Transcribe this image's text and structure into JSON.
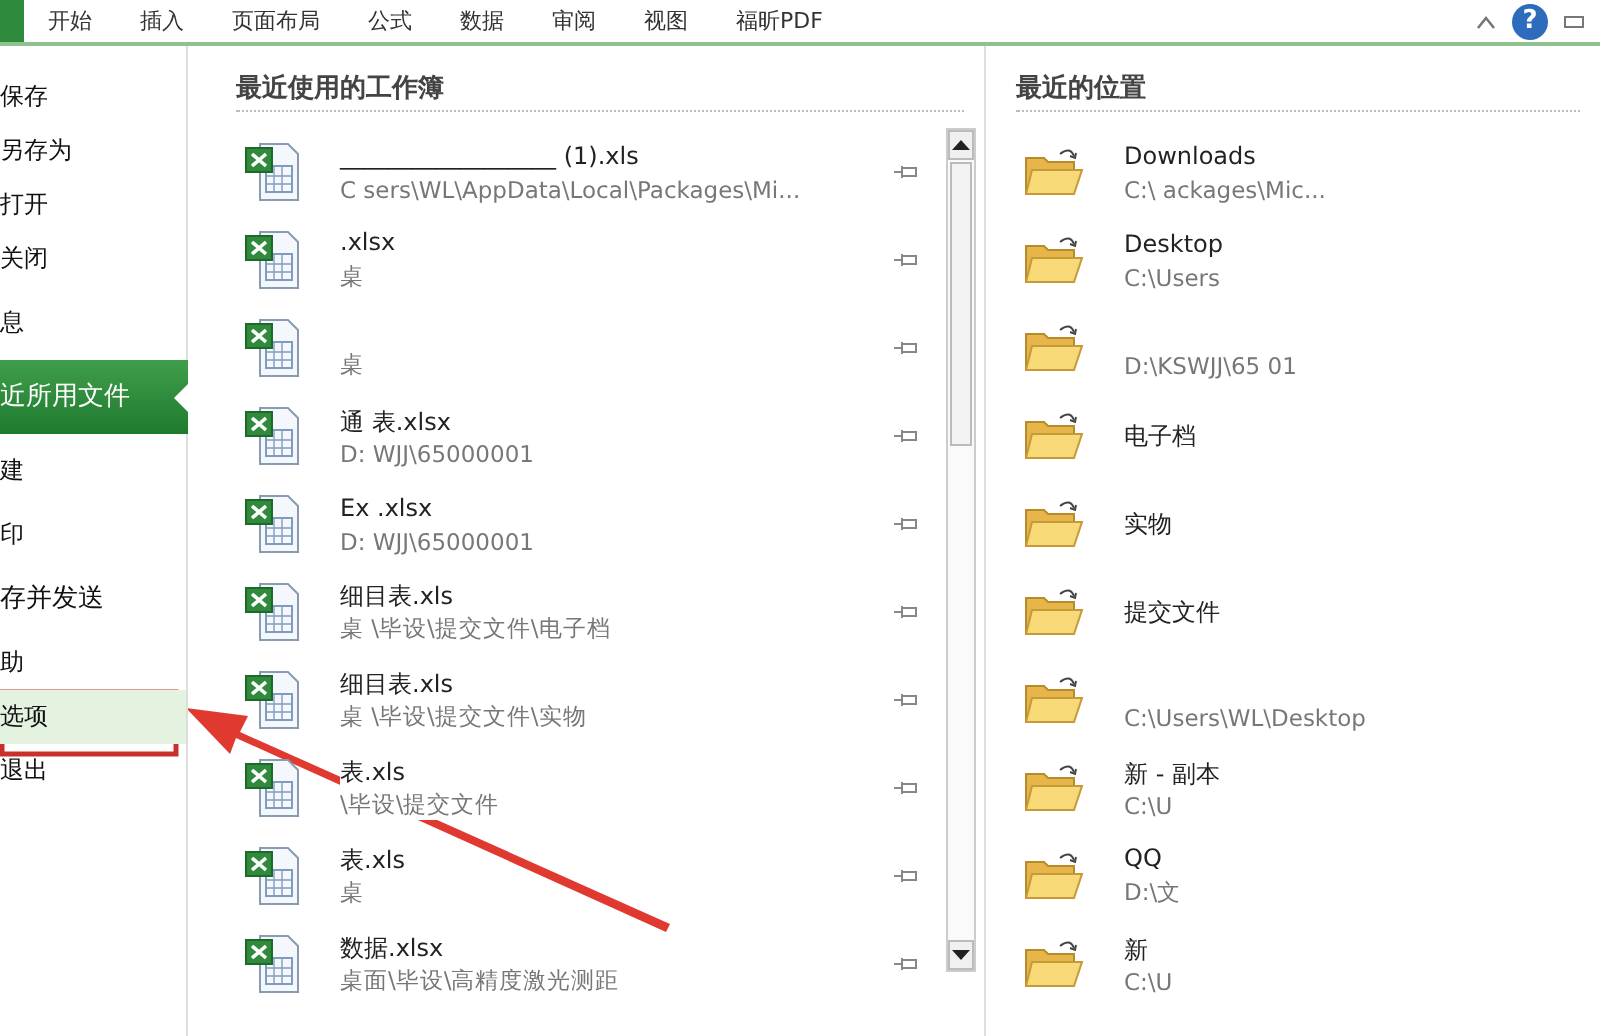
{
  "ribbon": {
    "file_tab_selected": true,
    "help_label": "?",
    "tabs": [
      {
        "label": "开始"
      },
      {
        "label": "插入"
      },
      {
        "label": "页面布局"
      },
      {
        "label": "公式"
      },
      {
        "label": "数据"
      },
      {
        "label": "审阅"
      },
      {
        "label": "视图"
      },
      {
        "label": "福昕PDF"
      }
    ]
  },
  "sidebar": {
    "items": [
      {
        "label": "保存",
        "selected": false,
        "highlighted": false
      },
      {
        "label": "另存为",
        "selected": false,
        "highlighted": false
      },
      {
        "label": "打开",
        "selected": false,
        "highlighted": false
      },
      {
        "label": "关闭",
        "selected": false,
        "highlighted": false
      },
      {
        "label": "息",
        "selected": false,
        "highlighted": false
      },
      {
        "label": "近所用文件",
        "selected": true,
        "highlighted": false
      },
      {
        "label": "建",
        "selected": false,
        "highlighted": false
      },
      {
        "label": "印",
        "selected": false,
        "highlighted": false
      },
      {
        "label": "存并发送",
        "selected": false,
        "highlighted": false
      },
      {
        "label": "助",
        "selected": false,
        "highlighted": false
      },
      {
        "label": "选项",
        "selected": false,
        "highlighted": true
      },
      {
        "label": "退出",
        "selected": false,
        "highlighted": false
      }
    ]
  },
  "recent_workbooks": {
    "title": "最近使用的工作簿",
    "items": [
      {
        "name": "__________________ (1).xls",
        "path": "C sers\\WL\\AppData\\Local\\Packages\\Mi..."
      },
      {
        "name": ".xlsx",
        "path": "桌"
      },
      {
        "path": "桌"
      },
      {
        "name": "通 表.xlsx",
        "path": "D: WJJ\\65000001"
      },
      {
        "name": "Ex .xlsx",
        "path": "D: WJJ\\65000001"
      },
      {
        "name": "细目表.xls",
        "path": "桌 \\毕设\\提交文件\\电子档"
      },
      {
        "name": "细目表.xls",
        "path": "桌 \\毕设\\提交文件\\实物"
      },
      {
        "name": "表.xls",
        "path": "\\毕设\\提交文件"
      },
      {
        "name": "表.xls",
        "path": "桌"
      },
      {
        "name": "数据.xlsx",
        "path": "桌面\\毕设\\高精度激光测距"
      }
    ]
  },
  "recent_places": {
    "title": "最近的位置",
    "items": [
      {
        "name": "Downloads",
        "path": "C:\\ ackages\\Mic..."
      },
      {
        "name": "Desktop",
        "path": "C:\\Users"
      },
      {
        "path": "D:\\KSWJJ\\65 01"
      },
      {
        "name": "电子档"
      },
      {
        "name": "实物"
      },
      {
        "name": "提交文件"
      },
      {
        "path": "C:\\Users\\WL\\Desktop"
      },
      {
        "name": "新 - 副本",
        "path": "C:\\U"
      },
      {
        "name": "QQ",
        "path": "D:\\文"
      },
      {
        "name": "新",
        "path": "C:\\U"
      }
    ]
  }
}
